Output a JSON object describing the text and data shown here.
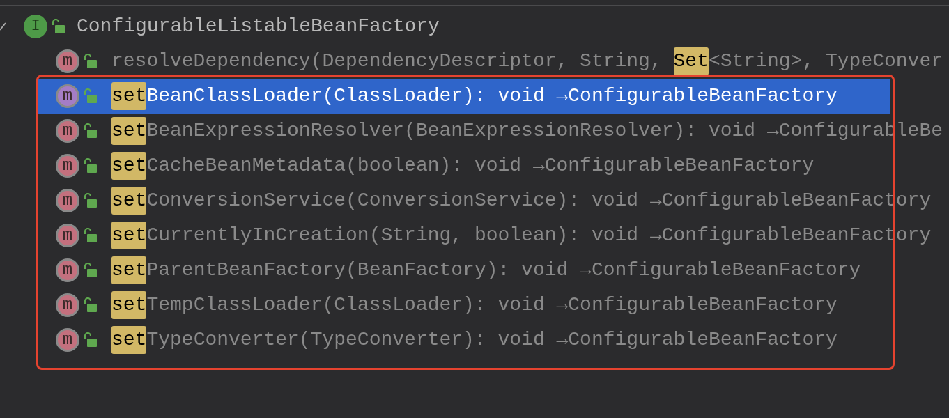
{
  "root": {
    "icon_letter": "I",
    "label": "ConfigurableListableBeanFactory",
    "expanded": true
  },
  "members": [
    {
      "icon_letter": "m",
      "selected": false,
      "in_frame": false,
      "segments": [
        {
          "text": "resolveDependency(DependencyDescriptor, String, ",
          "match": false
        },
        {
          "text": "Set",
          "match": true
        },
        {
          "text": "<String>, TypeConver",
          "match": false
        }
      ]
    },
    {
      "icon_letter": "m",
      "selected": true,
      "in_frame": true,
      "segments": [
        {
          "text": "set",
          "match": true
        },
        {
          "text": "BeanClassLoader(ClassLoader): void →ConfigurableBeanFactory",
          "match": false
        }
      ]
    },
    {
      "icon_letter": "m",
      "selected": false,
      "in_frame": true,
      "segments": [
        {
          "text": "set",
          "match": true
        },
        {
          "text": "BeanExpressionResolver(BeanExpressionResolver): void →ConfigurableBe",
          "match": false
        }
      ]
    },
    {
      "icon_letter": "m",
      "selected": false,
      "in_frame": true,
      "segments": [
        {
          "text": "set",
          "match": true
        },
        {
          "text": "CacheBeanMetadata(boolean): void →ConfigurableBeanFactory",
          "match": false
        }
      ]
    },
    {
      "icon_letter": "m",
      "selected": false,
      "in_frame": true,
      "segments": [
        {
          "text": "set",
          "match": true
        },
        {
          "text": "ConversionService(ConversionService): void →ConfigurableBeanFactory",
          "match": false
        }
      ]
    },
    {
      "icon_letter": "m",
      "selected": false,
      "in_frame": true,
      "segments": [
        {
          "text": "set",
          "match": true
        },
        {
          "text": "CurrentlyInCreation(String, boolean): void →ConfigurableBeanFactory",
          "match": false
        }
      ]
    },
    {
      "icon_letter": "m",
      "selected": false,
      "in_frame": true,
      "segments": [
        {
          "text": "set",
          "match": true
        },
        {
          "text": "ParentBeanFactory(BeanFactory): void →ConfigurableBeanFactory",
          "match": false
        }
      ]
    },
    {
      "icon_letter": "m",
      "selected": false,
      "in_frame": true,
      "segments": [
        {
          "text": "set",
          "match": true
        },
        {
          "text": "TempClassLoader(ClassLoader): void →ConfigurableBeanFactory",
          "match": false
        }
      ]
    },
    {
      "icon_letter": "m",
      "selected": false,
      "in_frame": true,
      "segments": [
        {
          "text": "set",
          "match": true
        },
        {
          "text": "TypeConverter(TypeConverter): void →ConfigurableBeanFactory",
          "match": false
        }
      ]
    }
  ]
}
